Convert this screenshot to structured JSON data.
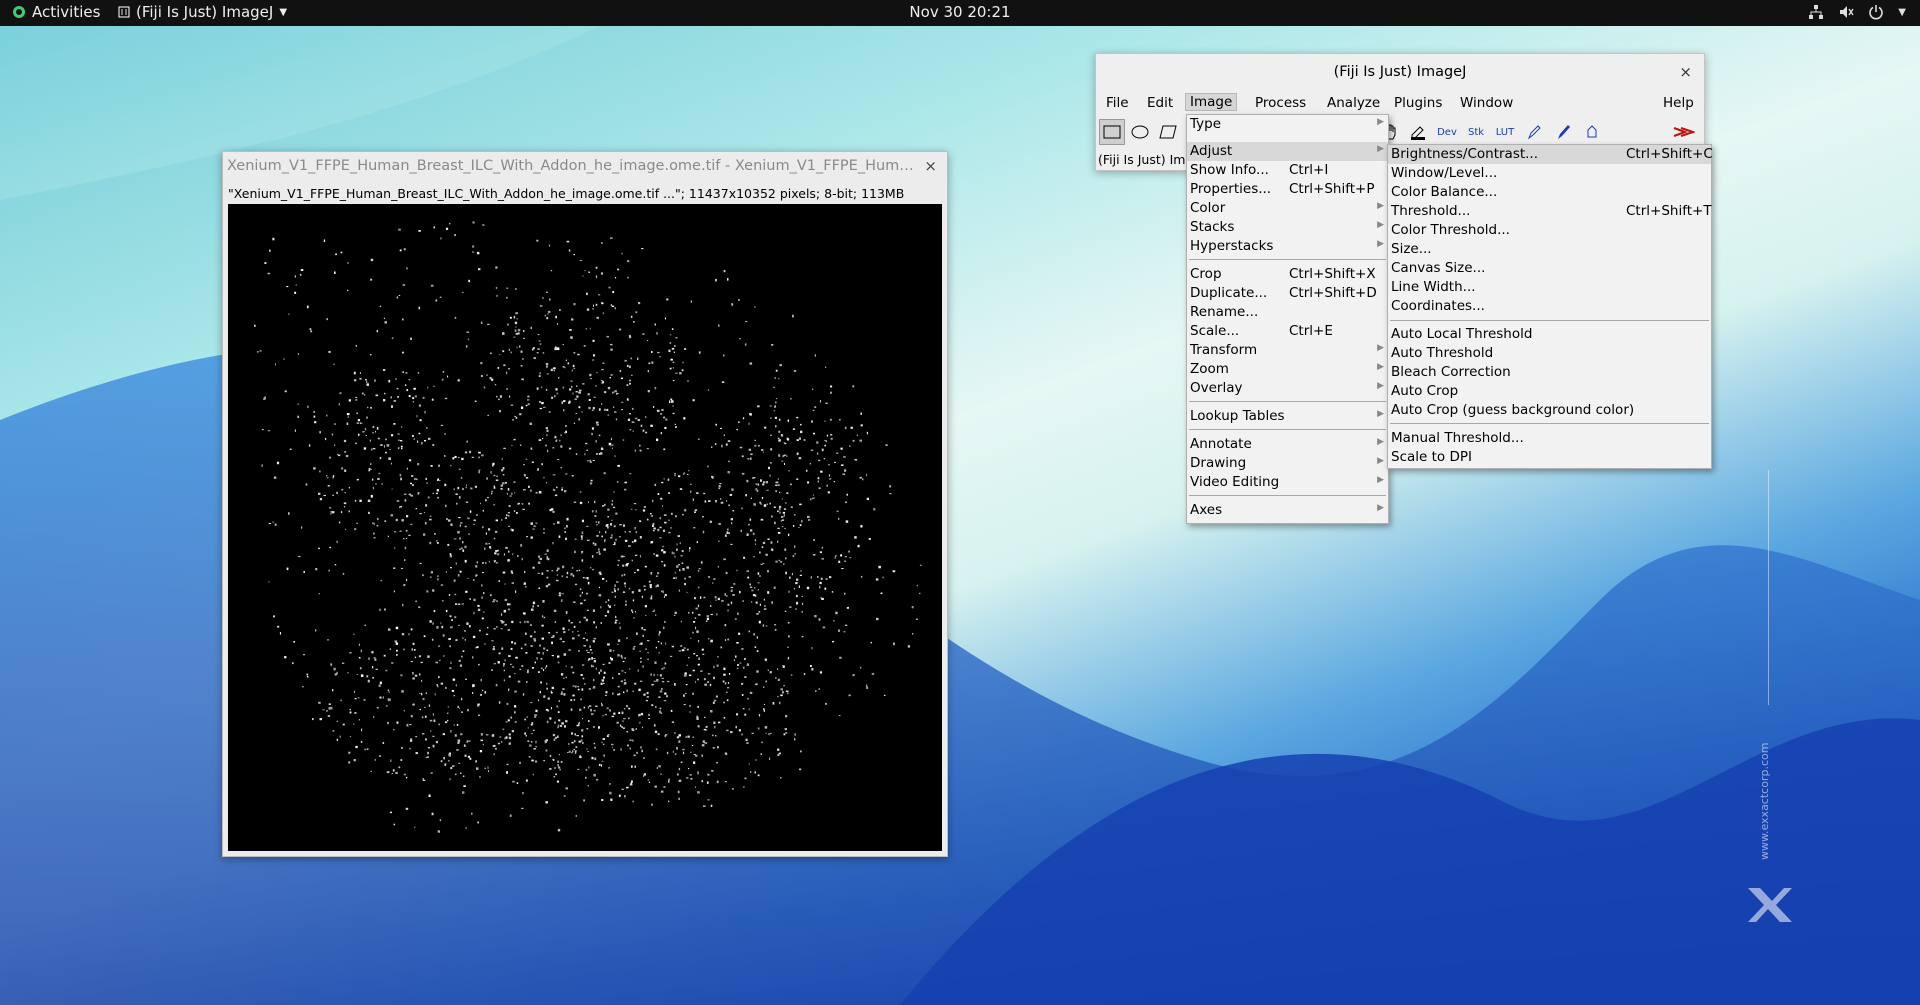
{
  "topbar": {
    "activities": "Activities",
    "app_name": "(Fiji Is Just) ImageJ",
    "clock": "Nov 30  20:21"
  },
  "image_window": {
    "title": "Xenium_V1_FFPE_Human_Breast_ILC_With_Addon_he_image.ome.tif - Xenium_V1_FFPE_Human...",
    "close": "×",
    "info": "\"Xenium_V1_FFPE_Human_Breast_ILC_With_Addon_he_image.ome.tif ...\"; 11437x10352 pixels; 8-bit; 113MB"
  },
  "imagej": {
    "title": "(Fiji Is Just) ImageJ",
    "close": "×",
    "menus": [
      "File",
      "Edit",
      "Image",
      "Process",
      "Analyze",
      "Plugins",
      "Window",
      "Help"
    ],
    "active_menu": "Image",
    "status": "(Fiji Is Just) Ima",
    "tools": [
      "Dev",
      "Stk",
      "LUT"
    ]
  },
  "image_menu": {
    "items": [
      {
        "label": "Type",
        "shortcut": "",
        "submenu": true
      },
      {
        "label": "Adjust",
        "shortcut": "",
        "submenu": true,
        "highlighted": true
      },
      {
        "label": "Show Info...",
        "shortcut": "Ctrl+I"
      },
      {
        "label": "Properties...",
        "shortcut": "Ctrl+Shift+P"
      },
      {
        "label": "Color",
        "shortcut": "",
        "submenu": true
      },
      {
        "label": "Stacks",
        "shortcut": "",
        "submenu": true
      },
      {
        "label": "Hyperstacks",
        "shortcut": "",
        "submenu": true
      },
      {
        "label": "Crop",
        "shortcut": "Ctrl+Shift+X"
      },
      {
        "label": "Duplicate...",
        "shortcut": "Ctrl+Shift+D"
      },
      {
        "label": "Rename...",
        "shortcut": ""
      },
      {
        "label": "Scale...",
        "shortcut": "Ctrl+E"
      },
      {
        "label": "Transform",
        "shortcut": "",
        "submenu": true
      },
      {
        "label": "Zoom",
        "shortcut": "",
        "submenu": true
      },
      {
        "label": "Overlay",
        "shortcut": "",
        "submenu": true
      },
      {
        "label": "Lookup Tables",
        "shortcut": "",
        "submenu": true
      },
      {
        "label": "Annotate",
        "shortcut": "",
        "submenu": true
      },
      {
        "label": "Drawing",
        "shortcut": "",
        "submenu": true
      },
      {
        "label": "Video Editing",
        "shortcut": "",
        "submenu": true
      },
      {
        "label": "Axes",
        "shortcut": "",
        "submenu": true
      }
    ]
  },
  "adjust_menu": {
    "items": [
      {
        "label": "Brightness/Contrast...",
        "shortcut": "Ctrl+Shift+C",
        "highlighted": true
      },
      {
        "label": "Window/Level...",
        "shortcut": ""
      },
      {
        "label": "Color Balance...",
        "shortcut": ""
      },
      {
        "label": "Threshold...",
        "shortcut": "Ctrl+Shift+T"
      },
      {
        "label": "Color Threshold...",
        "shortcut": ""
      },
      {
        "label": "Size...",
        "shortcut": ""
      },
      {
        "label": "Canvas Size...",
        "shortcut": ""
      },
      {
        "label": "Line Width...",
        "shortcut": ""
      },
      {
        "label": "Coordinates...",
        "shortcut": ""
      },
      {
        "label": "Auto Local Threshold",
        "shortcut": ""
      },
      {
        "label": "Auto Threshold",
        "shortcut": ""
      },
      {
        "label": "Bleach Correction",
        "shortcut": ""
      },
      {
        "label": "Auto Crop",
        "shortcut": ""
      },
      {
        "label": "Auto Crop (guess background color)",
        "shortcut": ""
      },
      {
        "label": "Manual Threshold...",
        "shortcut": ""
      },
      {
        "label": "Scale to DPI",
        "shortcut": ""
      }
    ]
  },
  "watermark": "www.exxactcorp.com",
  "colors": {
    "desktop_dark": "#1441a8",
    "topbar": "#111111",
    "menu_bg": "#f2f2f2",
    "highlight": "#d8d8d8"
  }
}
